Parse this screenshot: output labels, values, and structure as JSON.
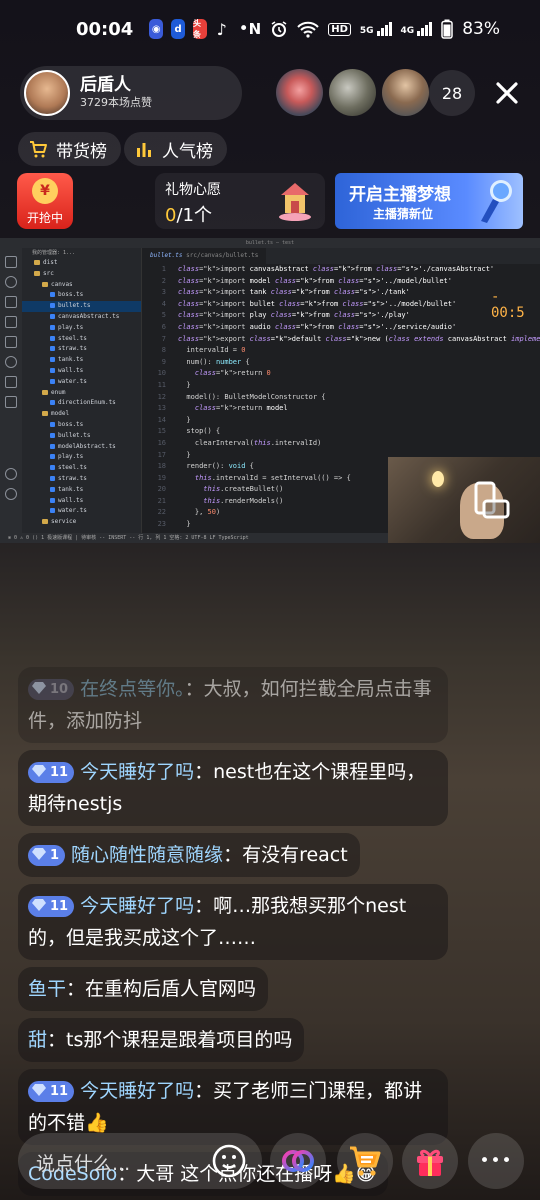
{
  "status_bar": {
    "time": "00:04",
    "app_icons": [
      "baidu-app-icon",
      "pinduoduo-app-icon",
      "toutiao-app-icon",
      "tiktok-app-icon"
    ],
    "toutiao_label": "头条",
    "dot": "•",
    "nfc": "N",
    "signal_hd": "HD",
    "signal_1": "5G",
    "signal_2": "4G",
    "battery": "83%"
  },
  "host": {
    "name": "后盾人",
    "likes": "3729本场点赞"
  },
  "viewers": {
    "count": "28"
  },
  "chips": {
    "shop": "带货榜",
    "popular": "人气榜"
  },
  "lucky_bag": {
    "coin": "¥",
    "label": "开抢中"
  },
  "gift_wish": {
    "title": "礼物心愿",
    "current": "0",
    "total": "/1个"
  },
  "banner": {
    "line1": "开启主播梦想",
    "line2": "主播猜新位"
  },
  "screen_share": {
    "window_title": "bullet.ts — test",
    "explorer_head": "我的管理器: 1...",
    "tree": [
      {
        "label": "dist",
        "kind": "folder",
        "indent": 1
      },
      {
        "label": "src",
        "kind": "folder",
        "indent": 1
      },
      {
        "label": "canvas",
        "kind": "folder",
        "indent": 2
      },
      {
        "label": "boss.ts",
        "kind": "file",
        "indent": 3
      },
      {
        "label": "bullet.ts",
        "kind": "file",
        "indent": 3,
        "selected": true
      },
      {
        "label": "canvasAbstract.ts",
        "kind": "file",
        "indent": 3
      },
      {
        "label": "play.ts",
        "kind": "file",
        "indent": 3
      },
      {
        "label": "steel.ts",
        "kind": "file",
        "indent": 3
      },
      {
        "label": "straw.ts",
        "kind": "file",
        "indent": 3
      },
      {
        "label": "tank.ts",
        "kind": "file",
        "indent": 3
      },
      {
        "label": "wall.ts",
        "kind": "file",
        "indent": 3
      },
      {
        "label": "water.ts",
        "kind": "file",
        "indent": 3
      },
      {
        "label": "enum",
        "kind": "folder",
        "indent": 2
      },
      {
        "label": "directionEnum.ts",
        "kind": "file",
        "indent": 3
      },
      {
        "label": "model",
        "kind": "folder",
        "indent": 2
      },
      {
        "label": "boss.ts",
        "kind": "file",
        "indent": 3
      },
      {
        "label": "bullet.ts",
        "kind": "file",
        "indent": 3
      },
      {
        "label": "modelAbstract.ts",
        "kind": "file",
        "indent": 3
      },
      {
        "label": "play.ts",
        "kind": "file",
        "indent": 3
      },
      {
        "label": "steel.ts",
        "kind": "file",
        "indent": 3
      },
      {
        "label": "straw.ts",
        "kind": "file",
        "indent": 3
      },
      {
        "label": "tank.ts",
        "kind": "file",
        "indent": 3
      },
      {
        "label": "wall.ts",
        "kind": "file",
        "indent": 3
      },
      {
        "label": "water.ts",
        "kind": "file",
        "indent": 3
      },
      {
        "label": "service",
        "kind": "folder",
        "indent": 2
      }
    ],
    "tab_filename": "bullet.ts",
    "tab_path": "src/canvas/bullet.ts",
    "timer": "- 00:5",
    "statusbar_text": "⊗ 0  ⚠ 0    ⟨⟩ 1    极速版课程 | 待审核  -- INSERT --               行 1, 列 1   空格: 2   UTF-8   LF   TypeScript",
    "code": [
      "import canvasAbstract from './canvasAbstract'",
      "import model from '../model/bullet'",
      "import tank from './tank'",
      "import bullet from '../model/bullet'",
      "import play from './play'",
      "import audio from '../service/audio'",
      "export default new (class extends canvasAbstract implements ICanvas {",
      "  intervalId = 0",
      "  num(): number {",
      "    return 0",
      "  }",
      "  model(): BulletModelConstructor {",
      "    return model",
      "  }",
      "  stop() {",
      "    clearInterval(this.intervalId)",
      "  }",
      "  render(): void {",
      "    this.intervalId = setInterval(() => {",
      "      this.createBullet()",
      "      this.renderModels()",
      "    }, 50)",
      "  }"
    ]
  },
  "comments": [
    {
      "level": "10",
      "user": "在终点等你。",
      "text": "：大叔，如何拦截全局点击事件，添加防抖",
      "faded": true
    },
    {
      "level": "11",
      "user": "今天睡好了吗",
      "text": "：nest也在这个课程里吗，期待nestjs"
    },
    {
      "level": "1",
      "user": "随心随性随意随缘",
      "text": "：有没有react"
    },
    {
      "level": "11",
      "user": "今天睡好了吗",
      "text": "：啊…那我想买那个nest的，但是我买成这个了……"
    },
    {
      "level": "",
      "user": "鱼干",
      "text": "：在重构后盾人官网吗"
    },
    {
      "level": "",
      "user": "甜",
      "text": "：ts那个课程是跟着项目的吗"
    },
    {
      "level": "11",
      "user": "今天睡好了吗",
      "text": "：买了老师三门课程，都讲的不错👍"
    },
    {
      "level": "",
      "user": "CodeSolo",
      "text": "：大哥 这个点你还在播呀👍😁"
    }
  ],
  "bottom": {
    "input_placeholder": "说点什么...",
    "more": "•••"
  }
}
